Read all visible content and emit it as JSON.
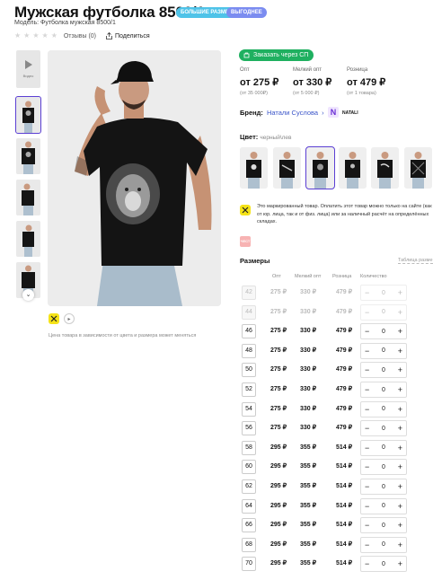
{
  "header": {
    "title": "Мужская футболка 8500/1",
    "badges": [
      "БОЛЬШИЕ РАЗМЕРЫ",
      "ВЫГОДНЕЕ"
    ],
    "model": "Модель: Футболка мужская 8500/1",
    "reviews": "Отзывы (0)",
    "share": "Поделиться"
  },
  "gallery": {
    "video_label": "Видео",
    "note": "Цена товара в зависимости от цвета и размера может меняться"
  },
  "purchase": {
    "sp_button": "Заказать через СП",
    "prices": [
      {
        "label": "Опт",
        "value": "от 275 ₽",
        "sub": "(от 35 000₽)"
      },
      {
        "label": "Мелкий опт",
        "value": "от 330 ₽",
        "sub": "(от 5 000 ₽)"
      },
      {
        "label": "Розница",
        "value": "от 479 ₽",
        "sub": "(от 1 товара)"
      }
    ],
    "brand_label": "Бренд:",
    "brand_link": "Натали Суслова",
    "brand_logo_text": "NATALI",
    "color_label": "Цвет:",
    "color_value": "черный\\лев",
    "marked_text": "Это маркированный товар. Оплатить этот товар можно только на сайте (как от юр. лица, так и от физ. лица) или за наличный расчёт на определённых складах.",
    "marked_badge": "ЧЕСТ ЗН",
    "sizes_title": "Размеры",
    "size_table_link": "Таблица разме",
    "columns": [
      "Опт",
      "Мелкий опт",
      "Розница",
      "Количество"
    ],
    "sizes": [
      {
        "size": "42",
        "opt": "275 ₽",
        "small": "330 ₽",
        "retail": "479 ₽",
        "qty": "0",
        "disabled": true
      },
      {
        "size": "44",
        "opt": "275 ₽",
        "small": "330 ₽",
        "retail": "479 ₽",
        "qty": "0",
        "disabled": true
      },
      {
        "size": "46",
        "opt": "275 ₽",
        "small": "330 ₽",
        "retail": "479 ₽",
        "qty": "0",
        "disabled": false
      },
      {
        "size": "48",
        "opt": "275 ₽",
        "small": "330 ₽",
        "retail": "479 ₽",
        "qty": "0",
        "disabled": false
      },
      {
        "size": "50",
        "opt": "275 ₽",
        "small": "330 ₽",
        "retail": "479 ₽",
        "qty": "0",
        "disabled": false
      },
      {
        "size": "52",
        "opt": "275 ₽",
        "small": "330 ₽",
        "retail": "479 ₽",
        "qty": "0",
        "disabled": false
      },
      {
        "size": "54",
        "opt": "275 ₽",
        "small": "330 ₽",
        "retail": "479 ₽",
        "qty": "0",
        "disabled": false
      },
      {
        "size": "56",
        "opt": "275 ₽",
        "small": "330 ₽",
        "retail": "479 ₽",
        "qty": "0",
        "disabled": false
      },
      {
        "size": "58",
        "opt": "295 ₽",
        "small": "355 ₽",
        "retail": "514 ₽",
        "qty": "0",
        "disabled": false
      },
      {
        "size": "60",
        "opt": "295 ₽",
        "small": "355 ₽",
        "retail": "514 ₽",
        "qty": "0",
        "disabled": false
      },
      {
        "size": "62",
        "opt": "295 ₽",
        "small": "355 ₽",
        "retail": "514 ₽",
        "qty": "0",
        "disabled": false
      },
      {
        "size": "64",
        "opt": "295 ₽",
        "small": "355 ₽",
        "retail": "514 ₽",
        "qty": "0",
        "disabled": false
      },
      {
        "size": "66",
        "opt": "295 ₽",
        "small": "355 ₽",
        "retail": "514 ₽",
        "qty": "0",
        "disabled": false
      },
      {
        "size": "68",
        "opt": "295 ₽",
        "small": "355 ₽",
        "retail": "514 ₽",
        "qty": "0",
        "disabled": false
      },
      {
        "size": "70",
        "opt": "295 ₽",
        "small": "355 ₽",
        "retail": "514 ₽",
        "qty": "0",
        "disabled": false
      }
    ]
  },
  "colors": {
    "accent": "#5b3fd4",
    "sp_green": "#1fb060",
    "link_blue": "#3b55c9",
    "badge_blue": "#4fc3e8",
    "badge_violet": "#7b8cf0"
  },
  "icons": [
    "star-icon",
    "share-icon",
    "play-icon",
    "chevron-down-icon",
    "yandex-market-icon",
    "cart-icon",
    "minus-icon",
    "plus-icon"
  ]
}
